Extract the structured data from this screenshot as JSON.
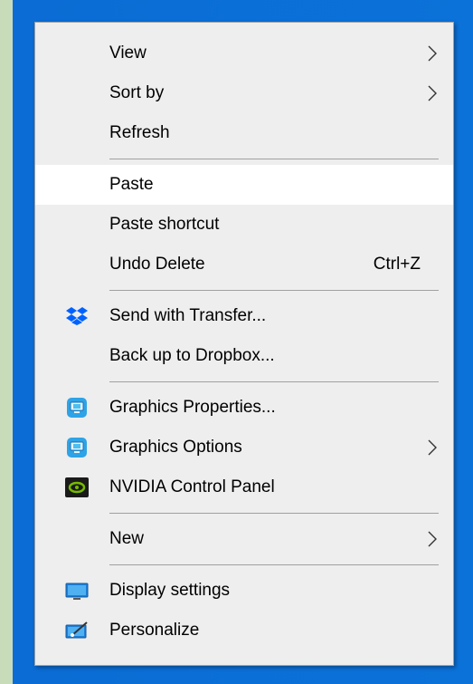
{
  "menu": {
    "group1": [
      {
        "label": "View",
        "submenu": true
      },
      {
        "label": "Sort by",
        "submenu": true
      },
      {
        "label": "Refresh"
      }
    ],
    "group2": [
      {
        "label": "Paste",
        "highlighted": true
      },
      {
        "label": "Paste shortcut"
      },
      {
        "label": "Undo Delete",
        "shortcut": "Ctrl+Z"
      }
    ],
    "group3": [
      {
        "label": "Send with Transfer...",
        "icon": "dropbox-icon"
      },
      {
        "label": "Back up to Dropbox..."
      }
    ],
    "group4": [
      {
        "label": "Graphics Properties...",
        "icon": "intel-graphics-icon"
      },
      {
        "label": "Graphics Options",
        "icon": "intel-graphics-icon",
        "submenu": true
      },
      {
        "label": "NVIDIA Control Panel",
        "icon": "nvidia-icon"
      }
    ],
    "group5": [
      {
        "label": "New",
        "submenu": true
      }
    ],
    "group6": [
      {
        "label": "Display settings",
        "icon": "display-icon"
      },
      {
        "label": "Personalize",
        "icon": "personalize-icon"
      }
    ]
  },
  "colors": {
    "menu_background": "#eeeeee",
    "highlight": "#ffffff",
    "desktop_blue": "#0a6cd4",
    "left_strip": "#c8dcba",
    "dropbox_blue": "#0061fe",
    "nvidia_green": "#76b900"
  }
}
